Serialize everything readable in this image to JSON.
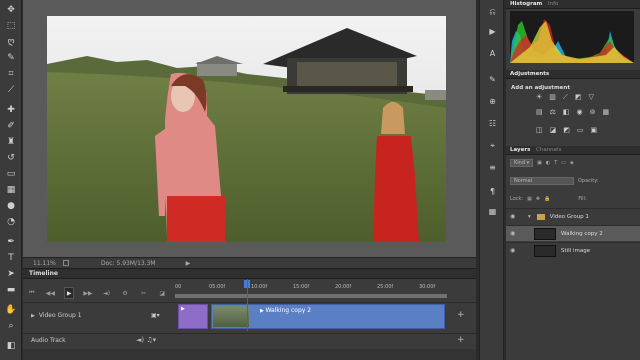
{
  "document": {
    "zoom": "11.11%",
    "doc_size": "Doc: 5.93M/13.3M"
  },
  "timeline": {
    "panel_title": "Timeline",
    "ruler_ticks": [
      "00",
      "05:00f",
      "10:00f",
      "15:00f",
      "20:00f",
      "25:00f",
      "30:00f"
    ],
    "video_group_label": "Video Group 1",
    "clip_name": "Walking copy 2",
    "audio_track_label": "Audio Track"
  },
  "panels": {
    "histogram_tab": "Histogram",
    "info_tab": "Info",
    "adjustments_tab": "Adjustments",
    "adjustments_heading": "Add an adjustment",
    "layers_tab": "Layers",
    "channels_tab": "Channels",
    "kind_filter": "Kind",
    "blend_mode": "Normal",
    "opacity_label": "Opacity:",
    "lock_label": "Lock:",
    "fill_label": "Fill:",
    "layers": [
      {
        "name": "Video Group 1",
        "type": "group"
      },
      {
        "name": "Walking copy 2",
        "type": "video"
      },
      {
        "name": "Still image",
        "type": "image"
      }
    ]
  },
  "colors": {
    "ui_panel": "#3b3b3b",
    "video_clip": "#5b7fc4",
    "transition_clip": "#8e6dc9",
    "playhead": "#cc3333"
  }
}
